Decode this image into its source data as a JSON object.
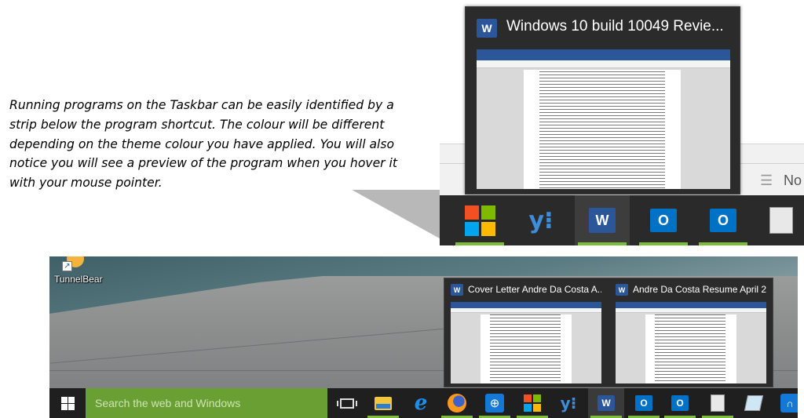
{
  "caption": {
    "lines": [
      "Running programs on the Taskbar can be easily identified by a",
      "strip below the program shortcut. The colour will be different",
      "depending on the theme colour you have applied. You will also",
      "notice you will see a preview of the program when you hover it",
      "with your mouse pointer."
    ]
  },
  "zoom": {
    "preview_title": "Windows 10 build 10049 Revie...",
    "word_glyph": "W",
    "background_text": "No",
    "taskbar_icons": [
      "windows-logo",
      "yammer",
      "word",
      "outlook",
      "outlook",
      "document"
    ]
  },
  "desktop": {
    "desktop_icon_label": "TunnelBear",
    "thumbnails": [
      {
        "title": "Cover Letter Andre Da Costa A..."
      },
      {
        "title": "Andre Da Costa Resume April 2..."
      }
    ],
    "taskbar": {
      "search_placeholder": "Search the web and Windows",
      "search_color": "#6aa033",
      "running_strip_color": "#7cbb3b"
    }
  },
  "glyphs": {
    "word": "W",
    "outlook": "O",
    "yammer": "y⁝",
    "ie": "e",
    "globe": "⊕",
    "headset": "∩",
    "arrow": "↗",
    "ruler": "☰"
  }
}
